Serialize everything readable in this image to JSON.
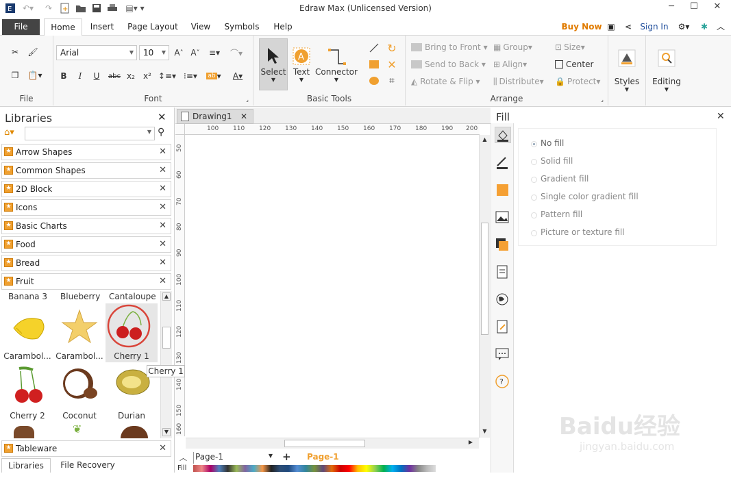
{
  "window": {
    "title": "Edraw Max (Unlicensed Version)"
  },
  "menu": {
    "file": "File",
    "tabs": [
      "Home",
      "Insert",
      "Page Layout",
      "View",
      "Symbols",
      "Help"
    ],
    "buy_now": "Buy Now",
    "sign_in": "Sign In"
  },
  "ribbon": {
    "file_group": "File",
    "font_group": "Font",
    "font_name": "Arial",
    "font_size": "10",
    "basic_tools_group": "Basic Tools",
    "select": "Select",
    "text": "Text",
    "connector": "Connector",
    "arrange_group": "Arrange",
    "bring_to_front": "Bring to Front",
    "send_to_back": "Send to Back",
    "rotate_flip": "Rotate & Flip",
    "group": "Group",
    "align": "Align",
    "distribute": "Distribute",
    "size": "Size",
    "center": "Center",
    "protect": "Protect",
    "styles": "Styles",
    "editing": "Editing"
  },
  "libraries": {
    "title": "Libraries",
    "items": [
      "Arrow Shapes",
      "Common Shapes",
      "2D Block",
      "Icons",
      "Basic Charts",
      "Food",
      "Bread",
      "Fruit"
    ],
    "fruit_top_labels": [
      "Banana 3",
      "Blueberry",
      "Cantaloupe"
    ],
    "shapes": [
      "Carambol...",
      "Carambol...",
      "Cherry 1",
      "Cherry 2",
      "Coconut",
      "Durian"
    ],
    "tooltip": "Cherry 1",
    "tableware": "Tableware",
    "bottom_tabs": [
      "Libraries",
      "File Recovery"
    ]
  },
  "canvas": {
    "tab": "Drawing1",
    "ruler_h": [
      "100",
      "110",
      "120",
      "130",
      "140",
      "150",
      "160",
      "170",
      "180",
      "190",
      "200"
    ],
    "ruler_v": [
      "50",
      "60",
      "70",
      "80",
      "90",
      "100",
      "110",
      "120",
      "130",
      "140",
      "150",
      "160"
    ],
    "page_select": "Page-1",
    "page_tab": "Page-1",
    "fill_label": "Fill"
  },
  "fill": {
    "title": "Fill",
    "options": [
      "No fill",
      "Solid fill",
      "Gradient fill",
      "Single color gradient fill",
      "Pattern fill",
      "Picture or texture fill"
    ]
  },
  "watermark": {
    "text": "Baidu经验",
    "url": "jingyan.baidu.com"
  },
  "colors": {
    "accent": "#f0a030",
    "file_tab": "#444444",
    "buy_now": "#e07b00",
    "link": "#1f4e9c"
  }
}
